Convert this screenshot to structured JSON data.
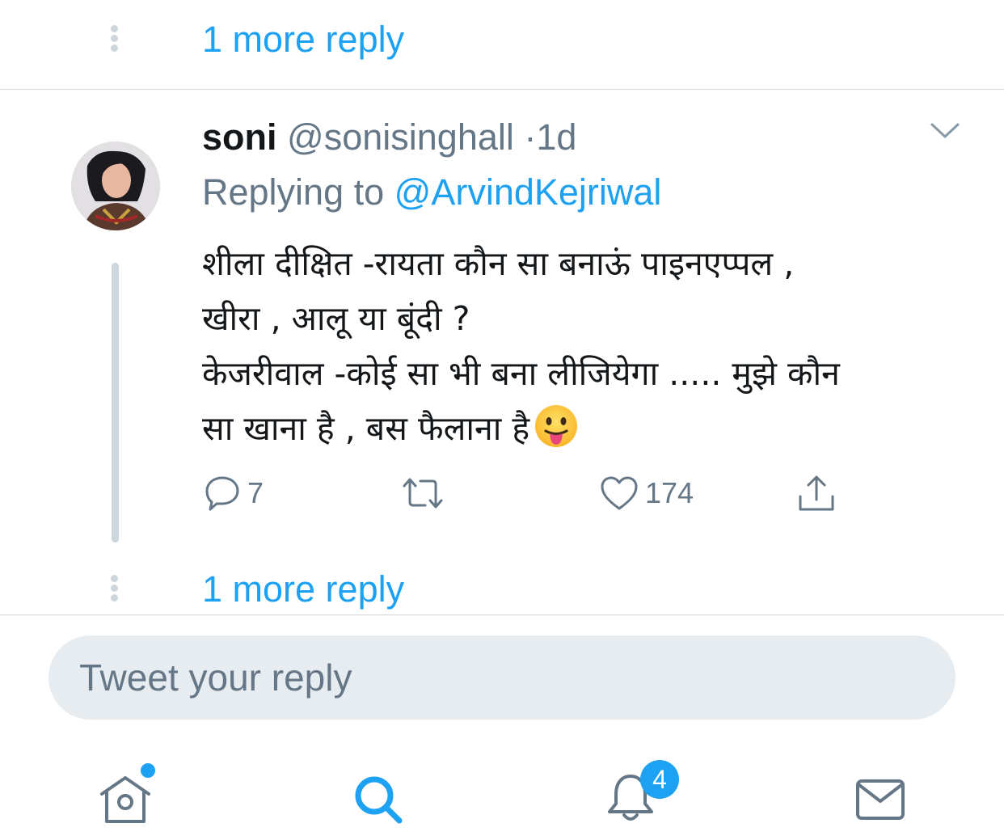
{
  "thread": {
    "more_reply_top": "1 more reply",
    "more_reply_bottom": "1 more reply"
  },
  "tweet": {
    "name": "soni",
    "handle": "@sonisinghall",
    "separator": "·",
    "time": "1d",
    "replying_prefix": "Replying to",
    "replying_mention": "@ArvindKejriwal",
    "text_lines": [
      "शीला दीक्षित -रायता कौन सा बनाऊं पाइनएप्पल ,",
      "खीरा , आलू या बूंदी ?",
      "केजरीवाल -कोई सा भी बना लीजियेगा ..... मुझे कौन",
      "सा खाना है , बस फैलाना है"
    ],
    "emoji": "face-with-stuck-out-tongue",
    "actions": {
      "reply_icon": "comment-icon",
      "reply_count": "7",
      "retweet_icon": "retweet-icon",
      "like_icon": "heart-icon",
      "like_count": "174",
      "share_icon": "share-icon"
    }
  },
  "reply_box": {
    "placeholder": "Tweet your reply"
  },
  "tabbar": {
    "home_icon": "home-icon",
    "search_icon": "search-icon",
    "notifications_icon": "bell-icon",
    "notifications_badge": "4",
    "messages_icon": "mail-icon"
  },
  "colors": {
    "accent": "#1da1f2",
    "secondary_text": "#657786",
    "divider": "#cfd9de",
    "reply_box_bg": "#e6ecf0"
  }
}
